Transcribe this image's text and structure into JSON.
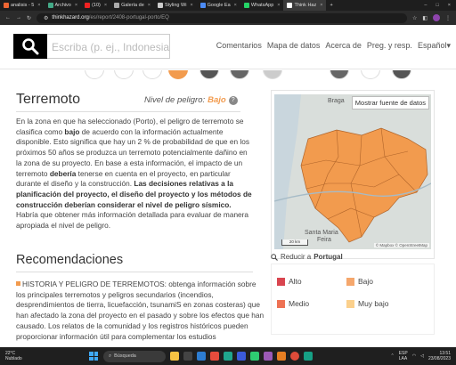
{
  "browser": {
    "tabs": [
      {
        "label": "analisis - 5",
        "active": false
      },
      {
        "label": "Archivo",
        "active": false
      },
      {
        "label": "(10)",
        "active": false
      },
      {
        "label": "Galería de",
        "active": false
      },
      {
        "label": "Styling Wi",
        "active": false
      },
      {
        "label": "Google Ea",
        "active": false
      },
      {
        "label": "WhatsApp",
        "active": false
      },
      {
        "label": "Think Haz",
        "active": true
      }
    ],
    "new_tab": "+",
    "url_host": "thinkhazard.org",
    "url_path": "/es/report/2408-portugal-porto/EQ"
  },
  "header": {
    "search_placeholder": "Escriba (p. ej., Indonesia c",
    "nav": [
      "Comentarios",
      "Mapa de datos",
      "Acerca de",
      "Preg. y resp.",
      "Español"
    ],
    "nav_caret": "▾"
  },
  "hazard": {
    "title": "Terremoto",
    "level_label": "Nivel de peligro:",
    "level_value": "Bajo",
    "help": "?",
    "p_intro": "En la zona en que ha seleccionado (Porto), el peligro de terremoto se clasifica como",
    "p_bajo": "bajo",
    "p_mid": "de acuerdo con la información actualmente disponible. Esto significa que hay un 2 % de probabilidad de que en los próximos 50 años se produzca un terremoto potencialmente dañino en la zona de su proyecto. En base a esta información, el impacto de un terremoto",
    "p_deberia": "debería",
    "p_mid2": "tenerse en cuenta en el proyecto, en particular durante el diseño y la construcción.",
    "p_bold": "Las decisiones relativas a la planificación del proyecto, el diseño del proyecto y los métodos de construcción deberían considerar el nivel de peligro sísmico.",
    "p_end": "Habría que obtener más información detallada para evaluar de manera apropiada el nivel de peligro."
  },
  "recommendations": {
    "title": "Recomendaciones",
    "text": "HISTORIA Y PELIGRO DE TERREMOTOS: obtenga información sobre los principales terremotos y peligros secundarios (incendios, desprendimientos de tierra, licuefacción, tsunamiS en zonas costeras) que han afectado la zona del proyecto en el pasado y sobre los efectos que han causado. Los relatos de la comunidad y los registros históricos pueden proporcionar información útil para complementar los estudios"
  },
  "map": {
    "button": "Mostrar fuente de datos",
    "labels": {
      "braga": "Braga",
      "santa_maria": "Santa Maria",
      "feira": "Feira"
    },
    "scale": "20 km",
    "attribution": "© Mapbox © OpenStreetMap",
    "reduce_prefix": "Reducir a",
    "reduce_place": "Portugal",
    "fill_color": "#f29b4e",
    "outline_color": "#b0642a"
  },
  "legend": [
    {
      "label": "Alto",
      "color": "#d9454f"
    },
    {
      "label": "Bajo",
      "color": "#f5a76c"
    },
    {
      "label": "Medio",
      "color": "#ee7254"
    },
    {
      "label": "Muy bajo",
      "color": "#fbd08c"
    }
  ],
  "taskbar": {
    "temp": "22°C",
    "condition": "Nublado",
    "search": "Búsqueda",
    "lang1": "ESP",
    "lang2": "LAA",
    "time": "13:51",
    "date": "23/08/2023"
  }
}
